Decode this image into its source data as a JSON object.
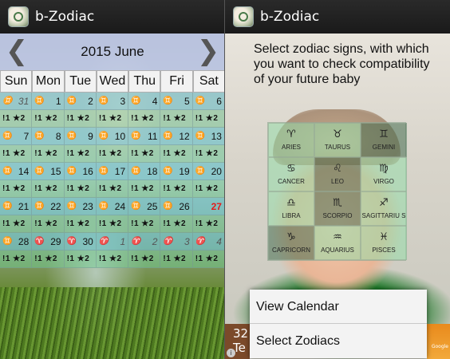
{
  "left_screen": {
    "app_title": "b-Zodiac",
    "month_label": "2015 June",
    "prev_arrow": "❮",
    "next_arrow": "❯",
    "weekdays": [
      "Sun",
      "Mon",
      "Tue",
      "Wed",
      "Thu",
      "Fri",
      "Sat"
    ],
    "weeks": [
      {
        "dates": [
          {
            "sign": "♊",
            "day": "31",
            "out": true
          },
          {
            "sign": "♊",
            "day": "1"
          },
          {
            "sign": "♊",
            "day": "2"
          },
          {
            "sign": "♊",
            "day": "3"
          },
          {
            "sign": "♊",
            "day": "4"
          },
          {
            "sign": "♊",
            "day": "5"
          },
          {
            "sign": "♊",
            "day": "6"
          }
        ],
        "infos": [
          "!1 ★2",
          "!1 ★2",
          "!1 ★2",
          "!1 ★2",
          "!1 ★2",
          "!1 ★2",
          "!1 ★2"
        ]
      },
      {
        "dates": [
          {
            "sign": "♊",
            "day": "7"
          },
          {
            "sign": "♊",
            "day": "8"
          },
          {
            "sign": "♊",
            "day": "9"
          },
          {
            "sign": "♊",
            "day": "10"
          },
          {
            "sign": "♊",
            "day": "11"
          },
          {
            "sign": "♊",
            "day": "12"
          },
          {
            "sign": "♊",
            "day": "13"
          }
        ],
        "infos": [
          "!1 ★2",
          "!1 ★2",
          "!1 ★2",
          "!1 ★2",
          "!1 ★2",
          "!1 ★2",
          "!1 ★2"
        ]
      },
      {
        "dates": [
          {
            "sign": "♊",
            "day": "14"
          },
          {
            "sign": "♊",
            "day": "15"
          },
          {
            "sign": "♊",
            "day": "16"
          },
          {
            "sign": "♊",
            "day": "17"
          },
          {
            "sign": "♊",
            "day": "18"
          },
          {
            "sign": "♊",
            "day": "19"
          },
          {
            "sign": "♊",
            "day": "20"
          }
        ],
        "infos": [
          "!1 ★2",
          "!1 ★2",
          "!1 ★2",
          "!1 ★2",
          "!1 ★2",
          "!1 ★2",
          "!1 ★2"
        ]
      },
      {
        "dates": [
          {
            "sign": "♊",
            "day": "21"
          },
          {
            "sign": "♊",
            "day": "22"
          },
          {
            "sign": "♊",
            "day": "23"
          },
          {
            "sign": "♊",
            "day": "24"
          },
          {
            "sign": "♊",
            "day": "25"
          },
          {
            "sign": "♊",
            "day": "26"
          },
          {
            "sign": "",
            "day": "27",
            "today": true
          }
        ],
        "infos": [
          "!1 ★2",
          "!1 ★2",
          "!1 ★2",
          "!1 ★2",
          "!1 ★2",
          "!1 ★2",
          "!1 ★2"
        ]
      },
      {
        "dates": [
          {
            "sign": "♊",
            "day": "28"
          },
          {
            "sign": "♈",
            "day": "29"
          },
          {
            "sign": "♈",
            "day": "30"
          },
          {
            "sign": "♈",
            "day": "1",
            "out": true
          },
          {
            "sign": "♈",
            "day": "2",
            "out": true
          },
          {
            "sign": "♈",
            "day": "3",
            "out": true
          },
          {
            "sign": "♈",
            "day": "4",
            "out": true
          }
        ],
        "infos": [
          "!1 ★2",
          "!1 ★2",
          "!1 ★2",
          "!1 ★2",
          "!1 ★2",
          "!1 ★2",
          "!1 ★2"
        ]
      }
    ]
  },
  "right_screen": {
    "app_title": "b-Zodiac",
    "prompt": "Select zodiac signs, with which you want to check compatibility of your future baby",
    "signs": [
      {
        "glyph": "♈",
        "name": "ARIES",
        "selected": false
      },
      {
        "glyph": "♉",
        "name": "TAURUS",
        "selected": false
      },
      {
        "glyph": "♊",
        "name": "GEMINI",
        "selected": true
      },
      {
        "glyph": "♋",
        "name": "CANCER",
        "selected": false
      },
      {
        "glyph": "♌",
        "name": "LEO",
        "selected": true
      },
      {
        "glyph": "♍",
        "name": "VIRGO",
        "selected": false
      },
      {
        "glyph": "♎",
        "name": "LIBRA",
        "selected": false
      },
      {
        "glyph": "♏",
        "name": "SCORPIO",
        "selected": true
      },
      {
        "glyph": "♐",
        "name": "SAGITTARIU S",
        "selected": false
      },
      {
        "glyph": "♑",
        "name": "CAPRICORN",
        "selected": true
      },
      {
        "glyph": "♒",
        "name": "AQUARIUS",
        "selected": false
      },
      {
        "glyph": "♓",
        "name": "PISCES",
        "selected": false
      }
    ],
    "menu": [
      "View Calendar",
      "Select Zodiacs"
    ],
    "ad_left_lines": [
      "32",
      "Te"
    ],
    "ad_info": "i",
    "ad_right_brand": "Google"
  },
  "colors": {
    "today_red": "#e41b1b",
    "date_cell": "#64c8d2",
    "info_cell": "#6ed296",
    "selected_sign": "#466e50",
    "action_bar": "#1a1a1a"
  }
}
